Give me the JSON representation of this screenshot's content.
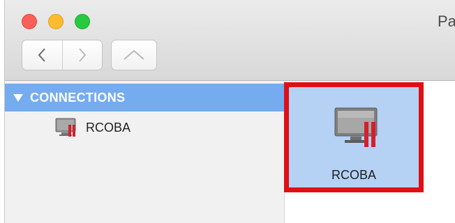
{
  "window": {
    "title": "Pa"
  },
  "toolbar": {
    "back_icon": "chevron-left-icon",
    "forward_icon": "chevron-right-icon",
    "up_icon": "chevron-up-icon",
    "sidebar_icon": "sidebar-toggle-icon"
  },
  "sidebar": {
    "section_title": "CONNECTIONS",
    "items": [
      {
        "label": "RCOBA",
        "icon": "server-connection-icon"
      }
    ]
  },
  "main": {
    "items": [
      {
        "label": "RCOBA",
        "icon": "server-connection-icon",
        "selected": true
      }
    ]
  },
  "colors": {
    "selection": "#75acf0",
    "item_highlight": "#b5d2f5",
    "annotation_box": "#e00f14",
    "close": "#fc5f57",
    "minimize": "#fdbc2e",
    "zoom": "#28c840"
  }
}
